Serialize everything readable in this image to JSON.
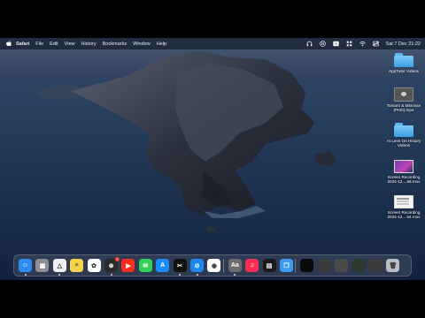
{
  "menubar": {
    "app_name": "Safari",
    "menus": [
      "File",
      "Edit",
      "View",
      "History",
      "Bookmarks",
      "Window",
      "Help"
    ],
    "status_icons": [
      "headphones-icon",
      "pause-icon",
      "text-input-icon",
      "grid-icon",
      "wifi-icon",
      "control-center-icon"
    ],
    "clock": "Sat 7 Dec  21:22"
  },
  "desktop": {
    "items": [
      {
        "kind": "folder",
        "icon": "folder-icon",
        "label": "AppTutor Videos"
      },
      {
        "kind": "doc",
        "icon": "video-file-icon",
        "label": "Tomaro & Mitrovan (PHD).mp4"
      },
      {
        "kind": "folder",
        "icon": "folder-icon",
        "label": "At Lens On History Videos"
      },
      {
        "kind": "shot",
        "icon": "screen-recording-thumbnail",
        "label": "Screen Recording 2024-12....58.mov"
      },
      {
        "kind": "shot2",
        "icon": "screen-recording-thumbnail",
        "label": "Screen Recording 2024-12....54.mov"
      }
    ]
  },
  "dock": {
    "apps": [
      {
        "name": "Finder",
        "icon": "finder-icon",
        "color": "#2f8cf3",
        "glyph": "☺",
        "running": true
      },
      {
        "name": "Launchpad",
        "icon": "launchpad-icon",
        "color": "#8e8e93",
        "glyph": "▦",
        "running": false
      },
      {
        "name": "Google Drive",
        "icon": "drive-icon",
        "color": "#f1f1f1",
        "glyph": "△",
        "running": true
      },
      {
        "name": "Notes",
        "icon": "notes-icon",
        "color": "#f8d24a",
        "glyph": "≡",
        "running": false
      },
      {
        "name": "Photos",
        "icon": "photos-icon",
        "color": "#ffffff",
        "glyph": "✿",
        "running": false
      },
      {
        "name": "ChatGPT",
        "icon": "chatgpt-icon",
        "color": "#2b2b2b",
        "glyph": "⊛",
        "running": true,
        "badge": "1"
      },
      {
        "name": "YouTube",
        "icon": "youtube-icon",
        "color": "#ff2d20",
        "glyph": "▶",
        "running": false
      },
      {
        "name": "Messages",
        "icon": "messages-icon",
        "color": "#33d05a",
        "glyph": "✉",
        "running": false
      },
      {
        "name": "App Store",
        "icon": "app-store-icon",
        "color": "#1a8cff",
        "glyph": "A",
        "running": false
      },
      {
        "name": "CapCut",
        "icon": "capcut-icon",
        "color": "#111111",
        "glyph": "✂",
        "running": true
      },
      {
        "name": "Safari",
        "icon": "safari-icon",
        "color": "#1e88f0",
        "glyph": "⊘",
        "running": true
      },
      {
        "name": "Chrome",
        "icon": "chrome-icon",
        "color": "#ffffff",
        "glyph": "◉",
        "running": false
      },
      {
        "name": "Font Book",
        "icon": "font-book-icon",
        "color": "#6d6d6d",
        "glyph": "Aa",
        "running": true
      },
      {
        "name": "Music",
        "icon": "music-icon",
        "color": "#fb2d55",
        "glyph": "♫",
        "running": false
      },
      {
        "name": "Activity Monitor",
        "icon": "activity-monitor-icon",
        "color": "#1a1a1a",
        "glyph": "▤",
        "running": false
      },
      {
        "name": "Shortcuts",
        "icon": "clipboard-icon",
        "color": "#3f9cf3",
        "glyph": "❐",
        "running": false
      },
      {
        "name": "Minimized Window 1",
        "icon": "minimized-window-icon",
        "color": "#0a0a0a",
        "glyph": "",
        "running": false
      },
      {
        "name": "Minimized Window 2",
        "icon": "minimized-window-icon",
        "color": "#3a3a3a",
        "glyph": "",
        "running": false
      },
      {
        "name": "Minimized Window 3",
        "icon": "minimized-window-icon",
        "color": "#4a4a4a",
        "glyph": "",
        "running": false
      },
      {
        "name": "Minimized Window 4",
        "icon": "minimized-window-icon",
        "color": "#2e3a2e",
        "glyph": "",
        "running": false
      },
      {
        "name": "Minimized Window 5",
        "icon": "minimized-window-icon",
        "color": "#3a3a3a",
        "glyph": "",
        "running": false
      },
      {
        "name": "Trash",
        "icon": "trash-icon",
        "color": "#b8bcc2",
        "glyph": "🗑",
        "running": false
      }
    ]
  }
}
